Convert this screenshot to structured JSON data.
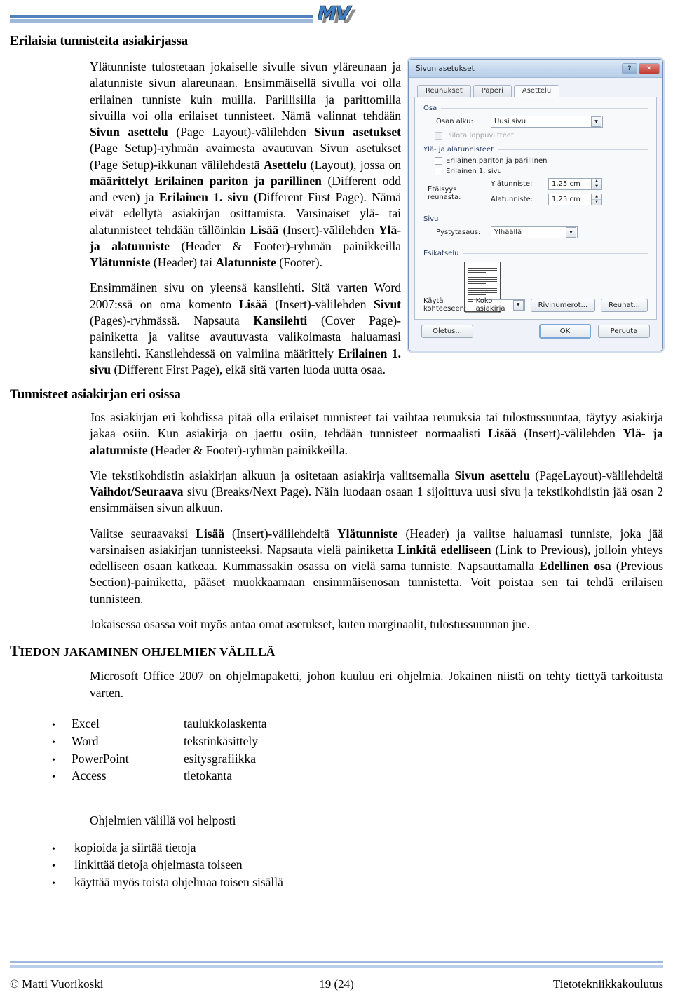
{
  "header": {
    "logo_text": "MV",
    "rule_color_dark": "#4f81bd",
    "rule_color_light": "#9cb9dc"
  },
  "headings": {
    "h1": "Erilaisia tunnisteita asiakirjassa",
    "h2": "Tunnisteet asiakirjan eri osissa",
    "h3_first_letter": "T",
    "h3_rest": "IEDON JAKAMINEN OHJELMIEN VÄLILLÄ"
  },
  "paragraphs": {
    "p1_a": "Ylätunniste tulostetaan jokaiselle sivulle sivun yläreunaan ja alatunniste sivun alareunaan. Ensimmäisellä sivulla voi olla erilainen tunniste kuin muilla. Parillisilla ja parittomilla sivuilla voi olla erilaiset tunnisteet. Nämä valinnat tehdään ",
    "p1_b1": "Sivun asettelu",
    "p1_c": " (Page Layout)-välilehden ",
    "p1_b2": "Sivun asetukset",
    "p1_d": " (Page Setup)-ryhmän avaimesta avautuvan Sivun asetukset (Page Setup)-ikkunan välilehdestä ",
    "p1_b3": "Asettelu",
    "p1_e": " (Layout), jossa on ",
    "p1_b4": "määrittelyt Erilainen pariton ja parillinen",
    "p1_f": " (Different odd and even) ja ",
    "p1_b5": "Erilainen 1. sivu",
    "p1_g": " (Different First Page). Nämä eivät edellytä asiakirjan osittamista. Varsinaiset ylä- tai alatunnisteet tehdään tällöinkin ",
    "p1_b6": "Lisää",
    "p1_h": " (Insert)-välilehden ",
    "p1_b7": "Ylä- ja alatunniste",
    "p1_i": " (Header & Footer)-ryhmän painikkeilla ",
    "p1_b8": "Ylätunniste",
    "p1_j": " (Header) tai ",
    "p1_b9": "Alatunniste",
    "p1_k": " (Footer).",
    "p2_a": "Ensimmäinen sivu on yleensä kansilehti. Sitä varten Word 2007:ssä on oma komento ",
    "p2_b1": "Lisää",
    "p2_b": " (Insert)-välilehden ",
    "p2_b2": "Sivut",
    "p2_c": " (Pages)-ryhmässä.  Napsauta ",
    "p2_b3": "Kansilehti",
    "p2_d": " (Cover Page)-painiketta ja valitse avautuvasta valikoimasta haluamasi kansilehti. Kansilehdessä on valmiina määrittely ",
    "p2_b4": "Erilainen 1. sivu",
    "p2_e": " (Different First Page), eikä sitä varten luoda uutta osaa.",
    "p3_a": "Jos asiakirjan eri kohdissa pitää olla erilaiset tunnisteet tai vaihtaa reunuksia tai tulostussuuntaa, täytyy asiakirja jakaa osiin. Kun asiakirja on jaettu osiin, tehdään tunnisteet normaalisti ",
    "p3_b1": "Lisää",
    "p3_b": " (Insert)-välilehden ",
    "p3_b2": "Ylä- ja alatunniste",
    "p3_c": " (Header & Footer)-ryhmän painikkeilla.",
    "p4_a": "Vie tekstikohdistin asiakirjan alkuun ja ositetaan asiakirja valitsemalla ",
    "p4_b1": "Sivun asettelu",
    "p4_b": " (PageLayout)-välilehdeltä  ",
    "p4_b2": "Vaihdot/Seuraava",
    "p4_c": " sivu (Breaks/Next Page). Näin luodaan osaan 1 sijoittuva uusi sivu ja tekstikohdistin jää osan 2 ensimmäisen sivun alkuun.",
    "p5_a": "Valitse seuraavaksi ",
    "p5_b1": "Lisää",
    "p5_b": " (Insert)-välilehdeltä ",
    "p5_b2": "Ylätunniste",
    "p5_c": " (Header) ja valitse haluamasi tunniste, joka jää varsinaisen asiakirjan tunnisteeksi. Napsauta vielä painiketta ",
    "p5_b3": "Linkitä edelliseen",
    "p5_d": " (Link to Previous), jolloin yhteys edelliseen osaan katkeaa. Kummassakin osassa on vielä sama tunniste. Napsauttamalla ",
    "p5_b4": "Edellinen osa",
    "p5_e": " (Previous Section)-painiketta, pääset muokkaamaan ensimmäisenosan tunnistetta. Voit poistaa sen tai tehdä erilaisen tunnisteen.",
    "p6": "Jokaisessa osassa voit myös antaa omat asetukset, kuten marginaalit, tulostussuunnan jne.",
    "p7": "Microsoft Office 2007 on ohjelmapaketti, johon kuuluu eri ohjelmia. Jokainen niistä on tehty tiettyä tarkoitusta varten.",
    "p8": "Ohjelmien välillä voi helposti"
  },
  "program_list": {
    "bullet": "•",
    "items": [
      {
        "name": "Excel",
        "desc": "taulukkolaskenta"
      },
      {
        "name": "Word",
        "desc": "tekstinkäsittely"
      },
      {
        "name": "PowerPoint",
        "desc": "esitysgrafiikka"
      },
      {
        "name": "Access",
        "desc": "tietokanta"
      }
    ]
  },
  "ability_list": {
    "bullet": "•",
    "items": [
      "kopioida ja siirtää tietoja",
      "linkittää tietoja ohjelmasta toiseen",
      "käyttää myös toista ohjelmaa toisen sisällä"
    ]
  },
  "dialog": {
    "title": "Sivun asetukset",
    "help_glyph": "?",
    "close_glyph": "✕",
    "tabs": [
      {
        "label": "Reunukset",
        "active": false
      },
      {
        "label": "Paperi",
        "active": false
      },
      {
        "label": "Asettelu",
        "active": true
      }
    ],
    "section_group": {
      "legend": "Osa",
      "start_label": "Osan alku:",
      "start_value": "Uusi sivu",
      "hide_endnotes_label": "Piilota loppuviitteet",
      "hide_endnotes_checked": false
    },
    "headers_group": {
      "legend": "Ylä- ja alatunnisteet",
      "different_odd_even_label": "Erilainen pariton ja parillinen",
      "different_odd_even_checked": false,
      "different_first_label": "Erilainen 1. sivu",
      "different_first_checked": false,
      "distance_label": "Etäisyys reunasta:",
      "header_label": "Ylätunniste:",
      "header_value": "1,25 cm",
      "footer_label": "Alatunniste:",
      "footer_value": "1,25 cm"
    },
    "page_group": {
      "legend": "Sivu",
      "valign_label": "Pystytasaus:",
      "valign_value": "Ylhäällä"
    },
    "preview_group": {
      "legend": "Esikatselu",
      "apply_label": "Käytä kohteeseen:",
      "apply_value": "Koko asiakirja",
      "line_numbers_button": "Rivinumerot...",
      "borders_button": "Reunat..."
    },
    "footer_buttons": {
      "default": "Oletus...",
      "ok": "OK",
      "cancel": "Peruuta"
    },
    "arrow_down_glyph": "▼",
    "arrow_up_glyph": "▲"
  },
  "footer": {
    "left": "© Matti Vuorikoski",
    "center": "19 (24)",
    "right": "Tietotekniikkakoulutus"
  }
}
